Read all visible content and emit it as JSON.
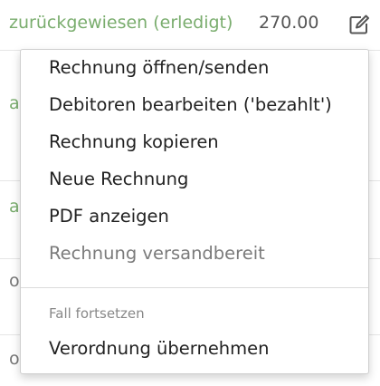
{
  "table": {
    "first_row": {
      "status": "zurückgewiesen (erledigt)",
      "amount": "270.00",
      "edit_icon": "edit-icon"
    },
    "peek_rows": [
      {
        "initial": "a"
      },
      {
        "initial": "a"
      },
      {
        "initial": "o"
      },
      {
        "initial": "o"
      }
    ]
  },
  "menu": {
    "items": [
      {
        "label": "Rechnung öffnen/senden",
        "enabled": true
      },
      {
        "label": "Debitoren bearbeiten ('bezahlt')",
        "enabled": true
      },
      {
        "label": "Rechnung kopieren",
        "enabled": true
      },
      {
        "label": "Neue Rechnung",
        "enabled": true
      },
      {
        "label": "PDF anzeigen",
        "enabled": true
      },
      {
        "label": "Rechnung versandbereit",
        "enabled": false
      }
    ],
    "section_header": "Fall fortsetzen",
    "section_items": [
      {
        "label": "Verordnung übernehmen",
        "enabled": true
      }
    ]
  },
  "colors": {
    "status_green": "#7aad6e",
    "text_dark": "#222222",
    "text_disabled": "#7b7b7b"
  }
}
